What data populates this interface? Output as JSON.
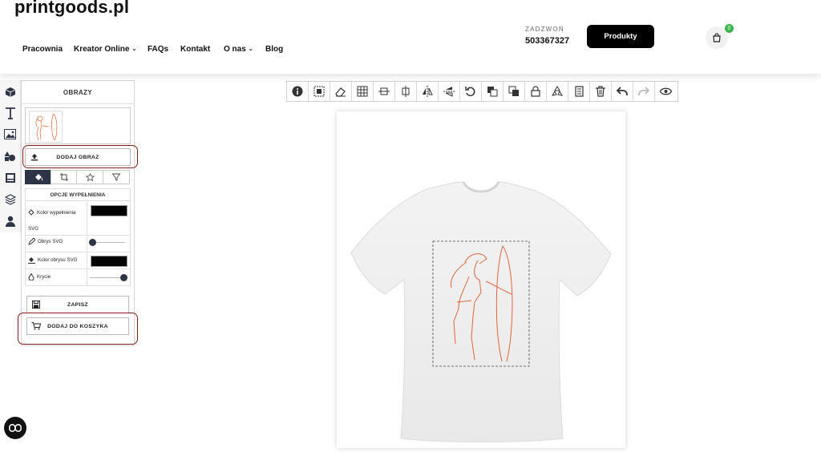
{
  "header": {
    "logo": "printgoods.pl",
    "nav": [
      {
        "label": "Pracownia"
      },
      {
        "label": "Kreator Online",
        "dropdown": true
      },
      {
        "label": "FAQs"
      },
      {
        "label": "Kontakt"
      },
      {
        "label": "O nas",
        "dropdown": true
      },
      {
        "label": "Blog"
      }
    ],
    "call_label": "ZADZWOŃ",
    "phone": "503367327",
    "products_button": "Produkty",
    "cart_count": "0"
  },
  "panel": {
    "title": "OBRAZY",
    "add_image": "DODAJ OBRAZ",
    "fill_options_title": "OPCJE WYPEŁNIENIA",
    "fill_color_label": "Kolor wypełnienia SVG",
    "stroke_label": "Obrys SVG",
    "stroke_color_label": "Kolor obrysu SVG",
    "opacity_label": "Krycie",
    "save": "ZAPISZ",
    "add_to_cart": "DODAJ DO KOSZYKA",
    "fill_color": "#000000",
    "stroke_color": "#000000",
    "stroke_value": 0,
    "opacity_value": 1
  },
  "toolbar": {
    "tools": [
      "info-icon",
      "center-icon",
      "eraser-icon",
      "grid-icon",
      "align-vertical-icon",
      "align-horizontal-icon",
      "flip-horizontal-icon",
      "flip-vertical-icon",
      "rotate-icon",
      "bring-forward-icon",
      "send-backward-icon",
      "lock-icon",
      "recycle-icon",
      "duplicate-icon",
      "trash-icon",
      "undo-icon",
      "redo-icon",
      "preview-icon"
    ]
  },
  "colors": {
    "accent": "#2d3446",
    "highlight": "#8b1a1a",
    "design": "#e0653a",
    "badge": "#3ab54a"
  }
}
